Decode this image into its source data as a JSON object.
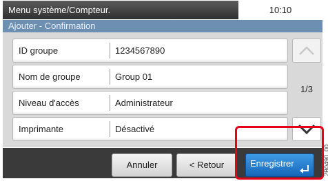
{
  "header": {
    "title": "Menu système/Compteur.",
    "time": "10:10",
    "subtitle": "Ajouter - Confirmation"
  },
  "rows": [
    {
      "label": "ID groupe",
      "value": "1234567890"
    },
    {
      "label": "Nom de groupe",
      "value": "Group 01"
    },
    {
      "label": "Niveau d'accès",
      "value": "Administrateur"
    },
    {
      "label": "Imprimante",
      "value": "Désactivé"
    }
  ],
  "pager": {
    "page": "1/3",
    "up_icon": "chevron-up-icon",
    "down_icon": "chevron-down-icon"
  },
  "footer": {
    "cancel_label": "Annuler",
    "back_label": "< Retour",
    "save_label": "Enregistrer",
    "save_icon": "enter-icon"
  },
  "figure_id": "2B0490_00"
}
